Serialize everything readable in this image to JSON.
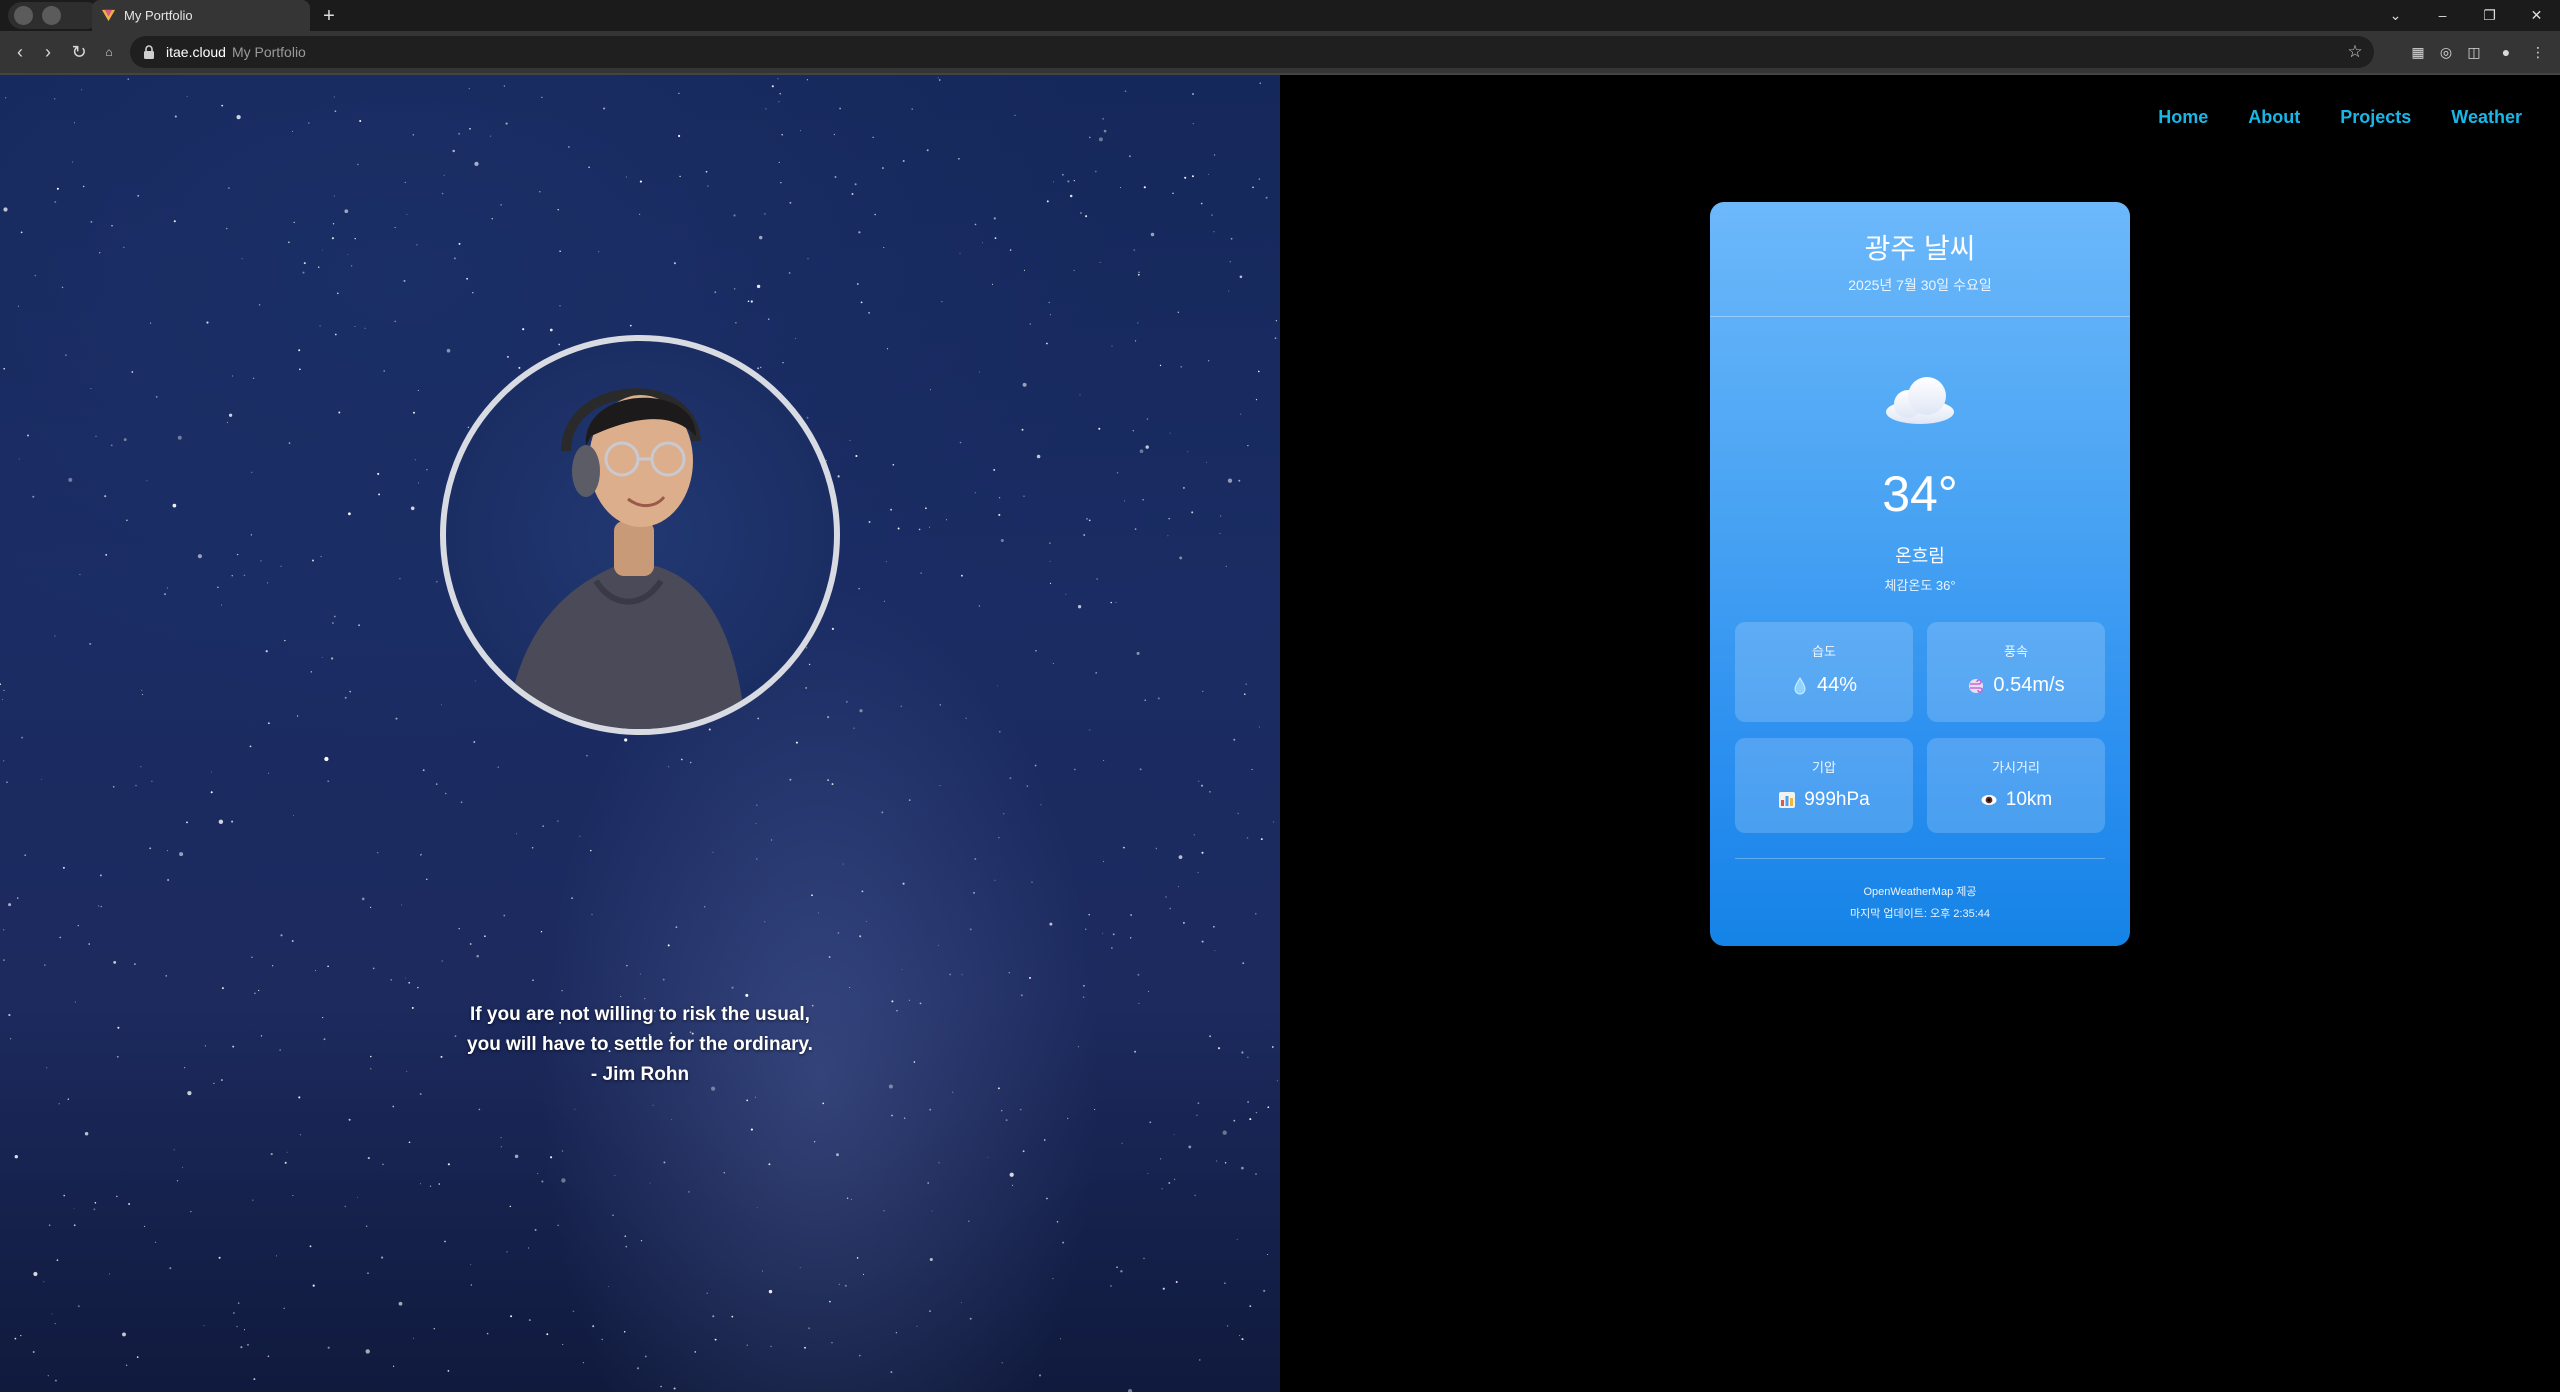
{
  "browser": {
    "tab_title": "My Portfolio",
    "new_tab": "+",
    "url_domain": "itae.cloud",
    "url_title": "My Portfolio"
  },
  "nav": {
    "items": [
      "Home",
      "About",
      "Projects",
      "Weather"
    ],
    "color": "#19b7e8"
  },
  "hero": {
    "quote_line1": "If you are not willing to risk the usual,",
    "quote_line2": "you will have to settle for the ordinary.",
    "quote_author": "- Jim Rohn"
  },
  "weather": {
    "city_title": "광주 날씨",
    "date": "2025년 7월 30일 수요일",
    "icon": "cloud-icon",
    "temperature": "34°",
    "description": "온흐림",
    "feels_like": "체감온도 36°",
    "stats": {
      "humidity": {
        "label": "습도",
        "value": "44%",
        "icon": "droplet-icon"
      },
      "wind": {
        "label": "풍속",
        "value": "0.54m/s",
        "icon": "wind-icon"
      },
      "pressure": {
        "label": "기압",
        "value": "999hPa",
        "icon": "bar-chart-icon"
      },
      "visibility": {
        "label": "가시거리",
        "value": "10km",
        "icon": "eye-icon"
      }
    },
    "source": "OpenWeatherMap 제공",
    "last_updated": "마지막 업데이트: 오후 2:35:44",
    "card_gradient_top": "#6cb8fb",
    "card_gradient_bottom": "#1583e6"
  }
}
